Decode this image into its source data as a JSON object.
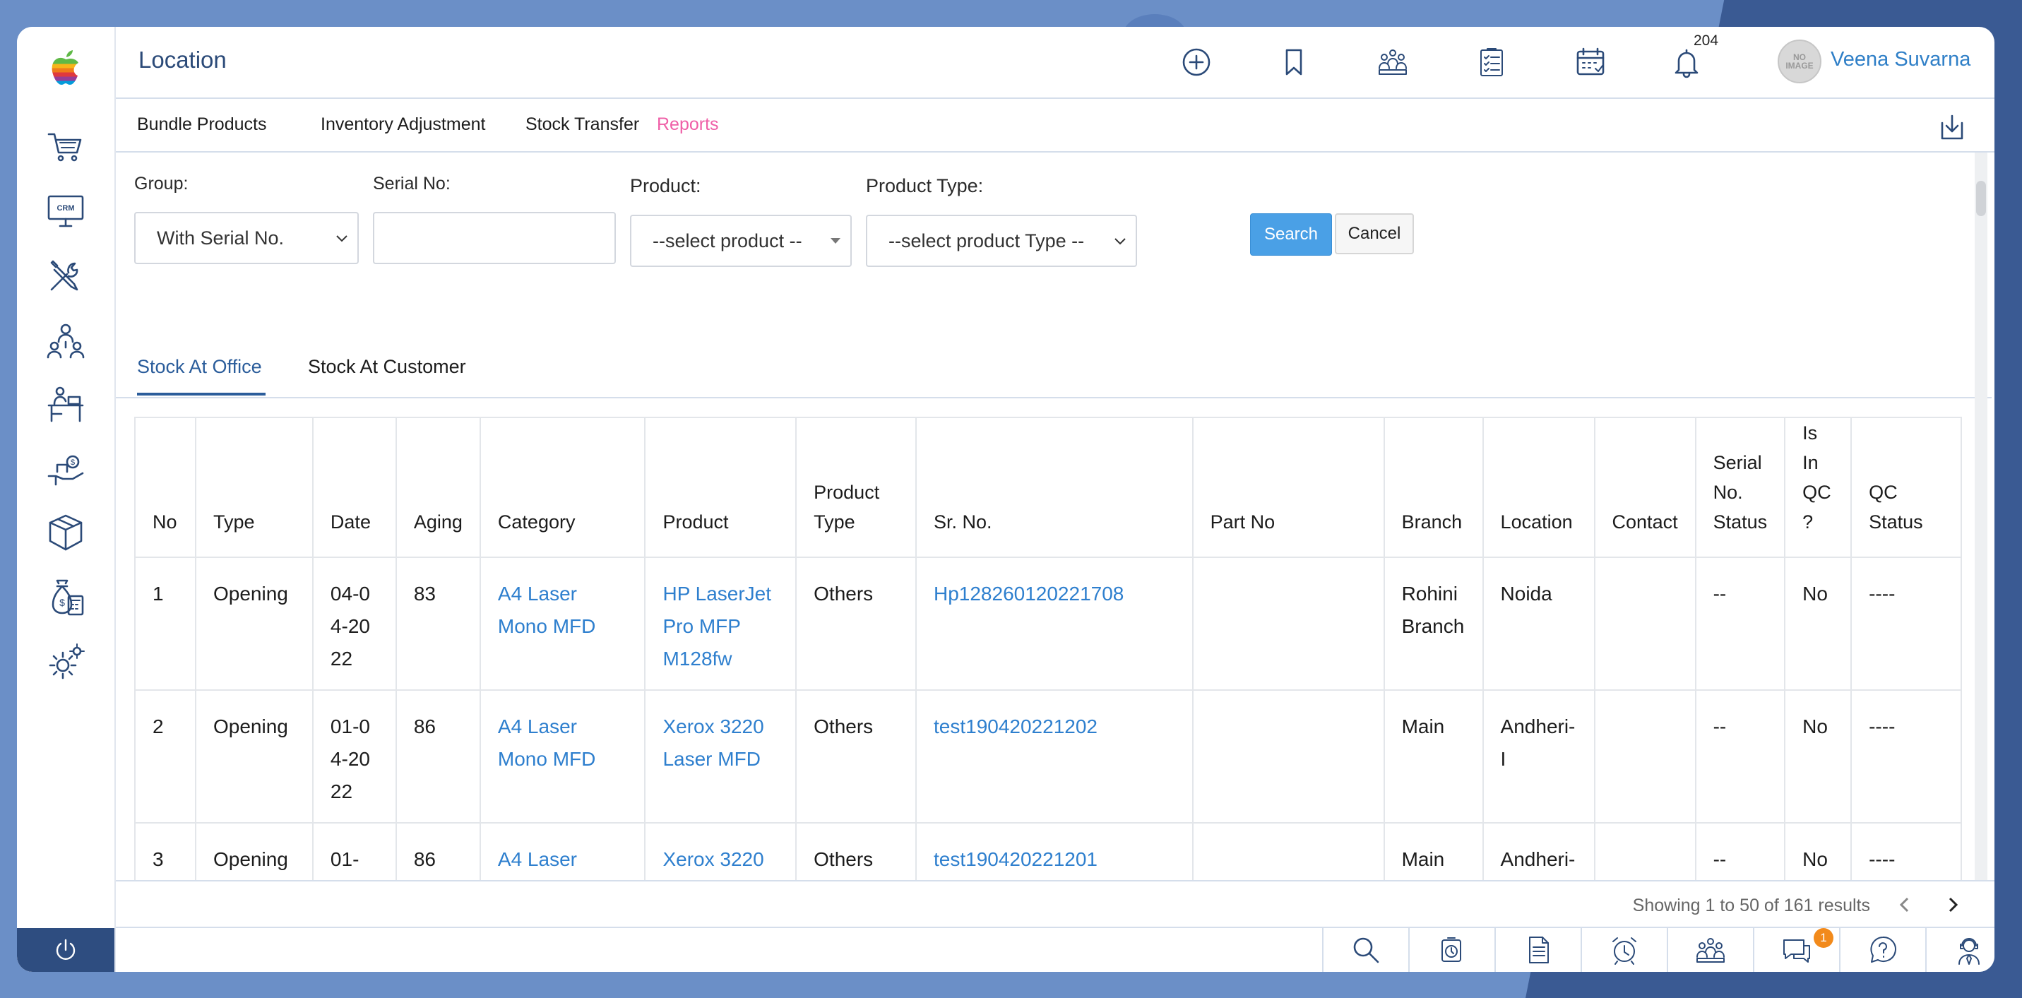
{
  "page_title": "Location",
  "user": {
    "name": "Veena Suvarna",
    "avatar_text": "NO IMAGE"
  },
  "notifications": {
    "count": "204"
  },
  "subnav": [
    {
      "label": "Bundle Products"
    },
    {
      "label": "Inventory Adjustment"
    },
    {
      "label": "Stock Transfer"
    },
    {
      "label": "Reports"
    }
  ],
  "filters": {
    "group_label": "Group:",
    "group_value": "With Serial No.",
    "serial_label": "Serial No:",
    "serial_value": "",
    "product_label": "Product:",
    "product_value": "--select product --",
    "product_type_label": "Product Type:",
    "product_type_value": "--select product Type --",
    "search_label": "Search",
    "cancel_label": "Cancel"
  },
  "tabs": [
    {
      "label": "Stock At Office"
    },
    {
      "label": "Stock At Customer"
    }
  ],
  "table": {
    "headers": [
      "No",
      "Type",
      "Date",
      "Aging",
      "Category",
      "Product",
      "Product Type",
      "Sr. No.",
      "Part No",
      "Branch",
      "Location",
      "Contact",
      "Serial No. Status",
      "Is In QC ?",
      "QC Status"
    ],
    "rows": [
      {
        "no": "1",
        "type": "Opening",
        "date": "04-04-2022",
        "aging": "83",
        "category": "A4 Laser Mono MFD",
        "product": "HP LaserJet Pro MFP M128fw",
        "product_type": "Others",
        "sr_no": "Hp128260120221708",
        "part_no": "",
        "branch": "Rohini Branch",
        "location": "Noida",
        "contact": "",
        "serial_status": "--",
        "in_qc": "No",
        "qc_status": "----"
      },
      {
        "no": "2",
        "type": "Opening",
        "date": "01-04-2022",
        "aging": "86",
        "category": "A4 Laser Mono MFD",
        "product": "Xerox 3220 Laser MFD",
        "product_type": "Others",
        "sr_no": "test190420221202",
        "part_no": "",
        "branch": "Main",
        "location": "Andheri-I",
        "contact": "",
        "serial_status": "--",
        "in_qc": "No",
        "qc_status": "----"
      },
      {
        "no": "3",
        "type": "Opening",
        "date": "01-",
        "aging": "86",
        "category": "A4 Laser",
        "product": "Xerox 3220",
        "product_type": "Others",
        "sr_no": "test190420221201",
        "part_no": "",
        "branch": "Main",
        "location": "Andheri-",
        "contact": "",
        "serial_status": "--",
        "in_qc": "No",
        "qc_status": "----"
      }
    ]
  },
  "pagination": {
    "text": "Showing 1 to 50 of 161 results"
  },
  "bottombar": {
    "chat_badge": "1"
  },
  "colors": {
    "accent": "#2b4a78",
    "link": "#2e7fce",
    "active_nav": "#ef5fa7",
    "search_button": "#4aa0e6",
    "power_bar": "#2e4d80",
    "chat_badge": "#f28a1b"
  }
}
